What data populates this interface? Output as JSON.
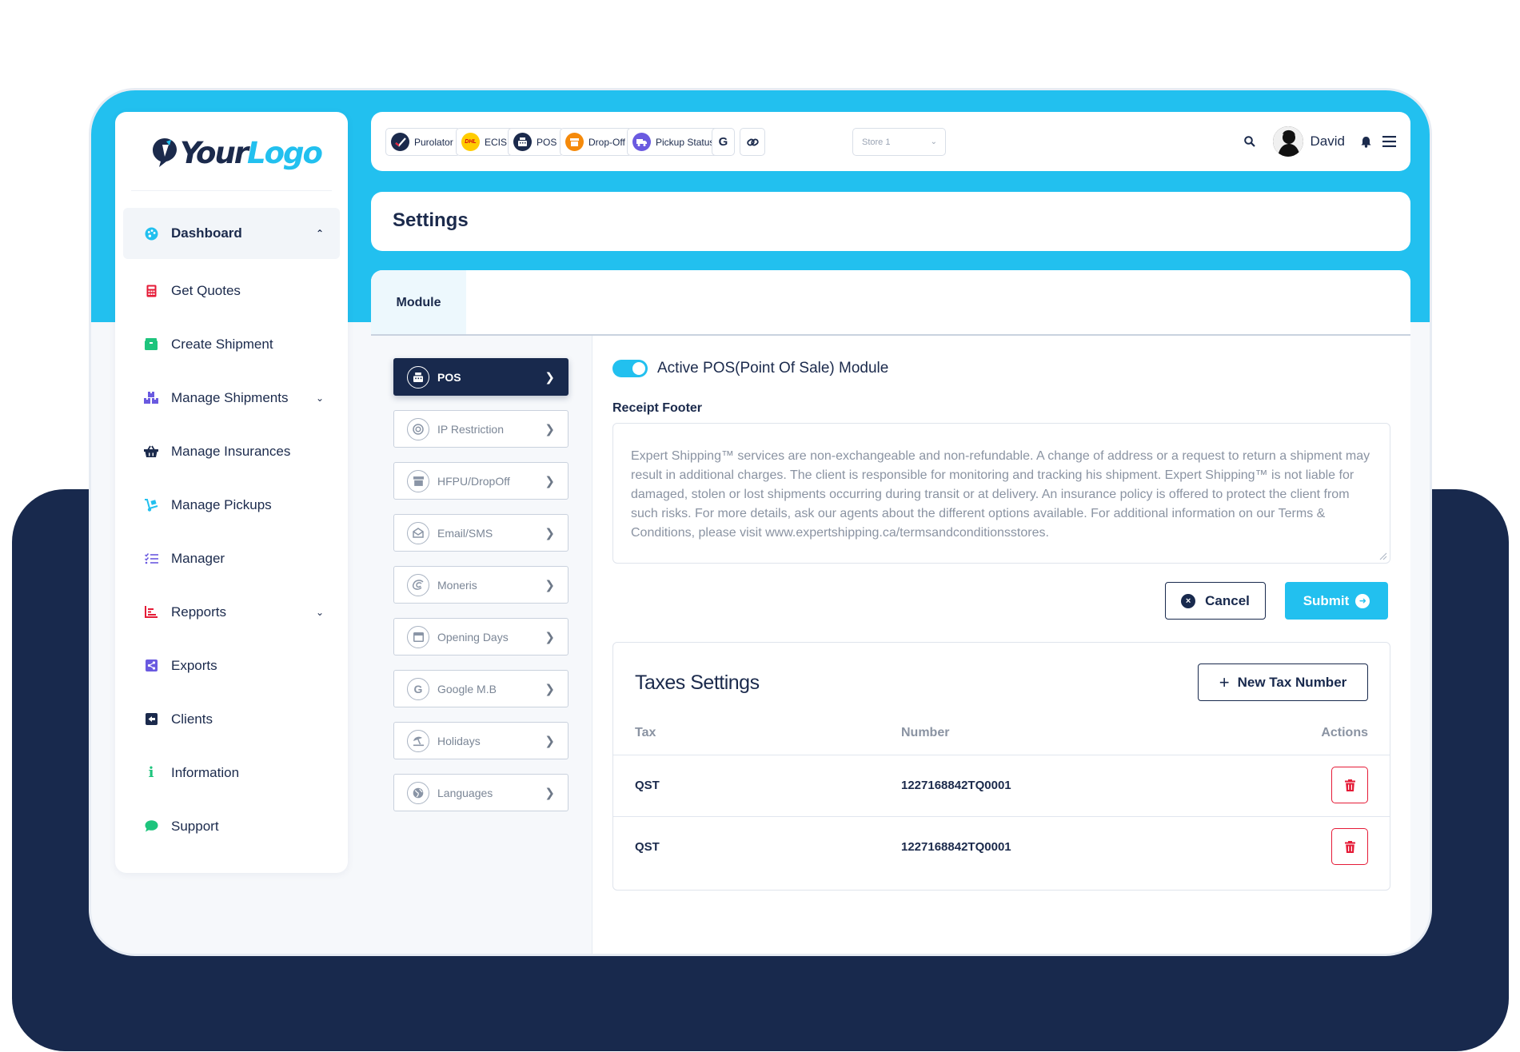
{
  "logo": {
    "part1": "Your",
    "part2": "Logo"
  },
  "sidebar": {
    "items": [
      {
        "label": "Dashboard",
        "icon": "palette-icon"
      },
      {
        "label": "Get Quotes",
        "icon": "calculator-icon"
      },
      {
        "label": "Create Shipment",
        "icon": "box-icon"
      },
      {
        "label": "Manage Shipments",
        "icon": "boxes-icon"
      },
      {
        "label": "Manage Insurances",
        "icon": "basket-icon"
      },
      {
        "label": "Manage Pickups",
        "icon": "dolly-icon"
      },
      {
        "label": "Manager",
        "icon": "list-check-icon"
      },
      {
        "label": "Repports",
        "icon": "bar-chart-icon"
      },
      {
        "label": "Exports",
        "icon": "share-icon"
      },
      {
        "label": "Clients",
        "icon": "share-square-icon"
      },
      {
        "label": "Information",
        "icon": "info-icon"
      },
      {
        "label": "Support",
        "icon": "chat-icon"
      }
    ]
  },
  "topbar": {
    "chips": [
      {
        "label": "Purolator",
        "icon": "purolator-icon"
      },
      {
        "label": "ECIS",
        "icon": "dhl-icon"
      },
      {
        "label": "POS",
        "icon": "cash-register-icon"
      },
      {
        "label": "Drop-Off",
        "icon": "store-icon"
      },
      {
        "label": "Pickup Status",
        "icon": "truck-icon"
      }
    ],
    "google_label": "G",
    "store_select": {
      "value": "Store 1"
    },
    "user_name": "David"
  },
  "page": {
    "title": "Settings"
  },
  "tabs": {
    "module": "Module"
  },
  "subnav": {
    "items": [
      {
        "label": "POS",
        "icon": "cash-register-icon",
        "active": true
      },
      {
        "label": "IP Restriction",
        "icon": "target-icon"
      },
      {
        "label": "HFPU/DropOff",
        "icon": "store-icon"
      },
      {
        "label": "Email/SMS",
        "icon": "envelope-open-icon"
      },
      {
        "label": "Moneris",
        "icon": "moneris-icon"
      },
      {
        "label": "Opening Days",
        "icon": "calendar-icon"
      },
      {
        "label": "Google M.B",
        "icon": "google-icon"
      },
      {
        "label": "Holidays",
        "icon": "umbrella-beach-icon"
      },
      {
        "label": "Languages",
        "icon": "globe-icon"
      }
    ]
  },
  "pos": {
    "toggle_label": "Active POS(Point Of Sale) Module",
    "toggle_on": true,
    "receipt_label": "Receipt Footer",
    "receipt_text": "Expert Shipping™ services are non-exchangeable and non-refundable. A change of address or a request to return a shipment may result in additional charges. The client is responsible for monitoring and tracking his shipment. Expert Shipping™ is not liable for damaged, stolen or lost shipments occurring during transit or at delivery. An insurance policy is offered to protect the client from such risks. For more details, ask our agents about the different options available. For additional information on our Terms & Conditions, please visit www.expertshipping.ca/termsandconditionsstores.",
    "cancel_label": "Cancel",
    "submit_label": "Submit"
  },
  "taxes": {
    "title": "Taxes Settings",
    "new_button": "New Tax Number",
    "columns": [
      "Tax",
      "Number",
      "Actions"
    ],
    "rows": [
      {
        "tax": "QST",
        "number": "1227168842TQ0001"
      },
      {
        "tax": "QST",
        "number": "1227168842TQ0001"
      }
    ]
  },
  "colors": {
    "accent": "#22c0ef",
    "navy": "#18294d",
    "danger": "#e51b37"
  }
}
